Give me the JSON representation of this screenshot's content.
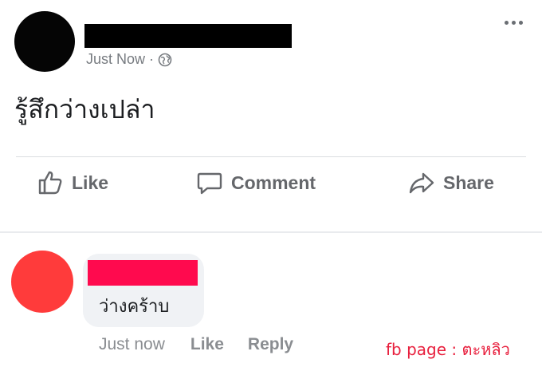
{
  "post": {
    "timestamp": "Just Now",
    "separator": "·",
    "privacy_icon": "globe-icon",
    "text": "รู้สึกว่างเปล่า"
  },
  "actions": {
    "like_label": "Like",
    "comment_label": "Comment",
    "share_label": "Share"
  },
  "comment": {
    "text": "ว่างคร้าบ",
    "timestamp": "Just now",
    "like_label": "Like",
    "reply_label": "Reply"
  },
  "watermark": "fb page : ตะหลิว",
  "colors": {
    "accent_text": "#65676b",
    "redacted_poster": "#000000",
    "redacted_commenter": "#ff0a4e",
    "commenter_avatar": "#ff3b3b",
    "watermark": "#e8203e"
  }
}
